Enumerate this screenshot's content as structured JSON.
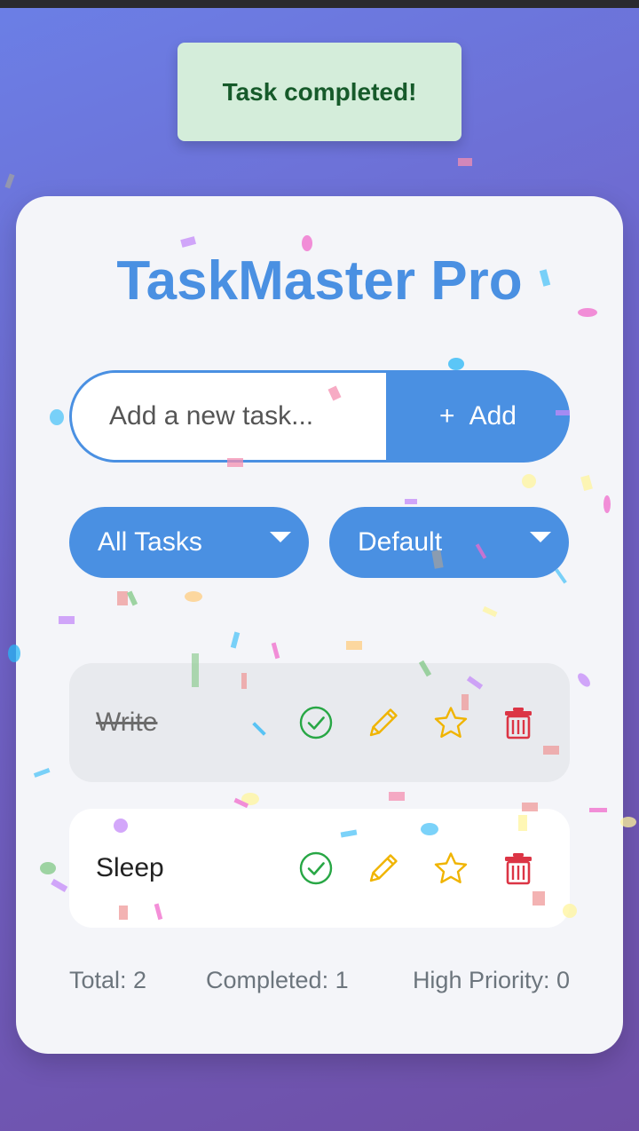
{
  "toast": {
    "message": "Task completed!"
  },
  "app": {
    "title": "TaskMaster Pro"
  },
  "add_task": {
    "placeholder": "Add a new task...",
    "plus_icon": "+",
    "button_label": "Add"
  },
  "filters": {
    "filter_value": "All Tasks",
    "sort_value": "Default"
  },
  "tasks": [
    {
      "text": "Write",
      "completed": true,
      "priority": false
    },
    {
      "text": "Sleep",
      "completed": false,
      "priority": false
    }
  ],
  "stats": {
    "total": "Total: 2",
    "completed": "Completed: 1",
    "high_priority": "High Priority: 0"
  },
  "icons": [
    "check-circle-icon",
    "pencil-icon",
    "star-icon",
    "trash-icon",
    "chevron-down-icon"
  ],
  "colors": {
    "accent": "#4a90e2",
    "complete": "#28a745",
    "edit": "#f0b400",
    "delete": "#dc3545",
    "toast_bg": "#d4edda",
    "toast_text": "#165a2a"
  }
}
